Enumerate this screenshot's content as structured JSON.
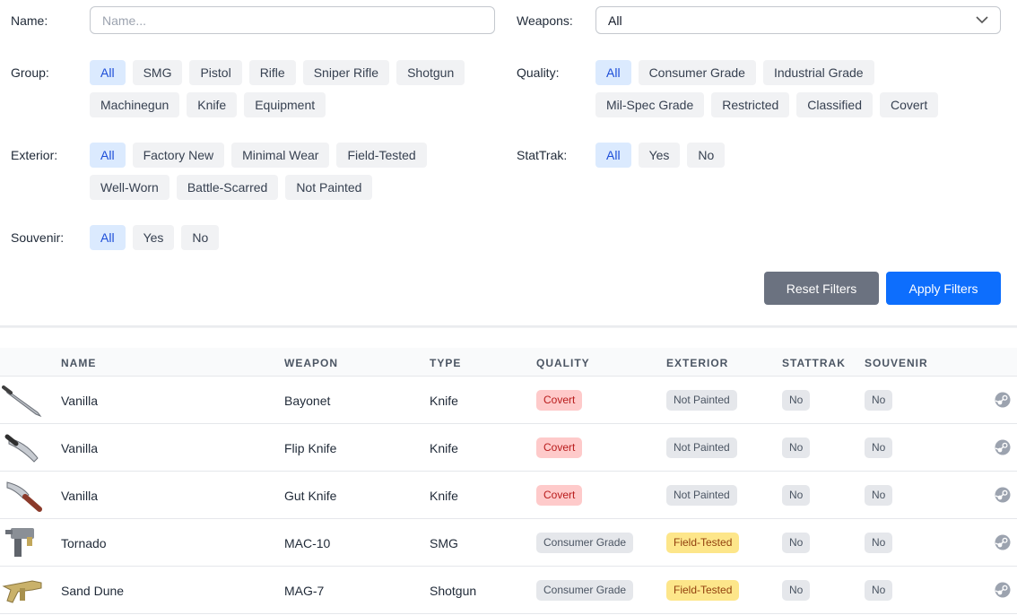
{
  "filters": {
    "name_label": "Name:",
    "name_placeholder": "Name...",
    "weapons_label": "Weapons:",
    "weapons_value": "All",
    "group_label": "Group:",
    "group_options": [
      "All",
      "SMG",
      "Pistol",
      "Rifle",
      "Sniper Rifle",
      "Shotgun",
      "Machinegun",
      "Knife",
      "Equipment"
    ],
    "quality_label": "Quality:",
    "quality_options": [
      "All",
      "Consumer Grade",
      "Industrial Grade",
      "Mil-Spec Grade",
      "Restricted",
      "Classified",
      "Covert"
    ],
    "exterior_label": "Exterior:",
    "exterior_options": [
      "All",
      "Factory New",
      "Minimal Wear",
      "Field-Tested",
      "Well-Worn",
      "Battle-Scarred",
      "Not Painted"
    ],
    "stattrak_label": "StatTrak:",
    "stattrak_options": [
      "All",
      "Yes",
      "No"
    ],
    "souvenir_label": "Souvenir:",
    "souvenir_options": [
      "All",
      "Yes",
      "No"
    ],
    "reset_label": "Reset Filters",
    "apply_label": "Apply Filters",
    "active_color": "#1d4ed8",
    "apply_color": "#0d6efd"
  },
  "table": {
    "headers": {
      "name": "NAME",
      "weapon": "WEAPON",
      "type": "TYPE",
      "quality": "QUALITY",
      "exterior": "EXTERIOR",
      "stattrak": "STATTRAK",
      "souvenir": "SOUVENIR"
    },
    "rows": [
      {
        "icon": "bayonet-knife-icon",
        "name": "Vanilla",
        "weapon": "Bayonet",
        "type": "Knife",
        "quality": "Covert",
        "exterior": "Not Painted",
        "stattrak": "No",
        "souvenir": "No"
      },
      {
        "icon": "flip-knife-icon",
        "name": "Vanilla",
        "weapon": "Flip Knife",
        "type": "Knife",
        "quality": "Covert",
        "exterior": "Not Painted",
        "stattrak": "No",
        "souvenir": "No"
      },
      {
        "icon": "gut-knife-icon",
        "name": "Vanilla",
        "weapon": "Gut Knife",
        "type": "Knife",
        "quality": "Covert",
        "exterior": "Not Painted",
        "stattrak": "No",
        "souvenir": "No"
      },
      {
        "icon": "mac10-icon",
        "name": "Tornado",
        "weapon": "MAC-10",
        "type": "SMG",
        "quality": "Consumer Grade",
        "exterior": "Field-Tested",
        "stattrak": "No",
        "souvenir": "No"
      },
      {
        "icon": "mag7-icon",
        "name": "Sand Dune",
        "weapon": "MAG-7",
        "type": "Shotgun",
        "quality": "Consumer Grade",
        "exterior": "Field-Tested",
        "stattrak": "No",
        "souvenir": "No"
      }
    ]
  }
}
